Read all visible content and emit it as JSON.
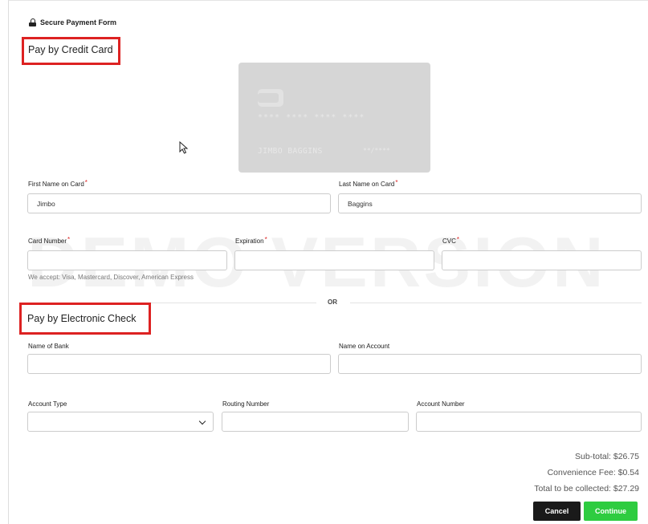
{
  "header": {
    "secure_label": "Secure Payment Form"
  },
  "credit_card": {
    "title": "Pay by Credit Card",
    "preview": {
      "number": "**** **** **** ****",
      "name": "JIMBO BAGGINS",
      "expiry": "**/****"
    },
    "first_name": {
      "label": "First Name on Card",
      "value": "Jimbo"
    },
    "last_name": {
      "label": "Last Name on Card",
      "value": "Baggins"
    },
    "card_number": {
      "label": "Card Number",
      "value": ""
    },
    "expiration": {
      "label": "Expiration",
      "value": ""
    },
    "cvc": {
      "label": "CVC",
      "value": ""
    },
    "accepted": "We accept: Visa, Mastercard, Discover, American Express",
    "required_mark": "*"
  },
  "watermark": "DEMO VERSION",
  "divider": "OR",
  "check": {
    "title": "Pay by Electronic Check",
    "bank_name": {
      "label": "Name of Bank",
      "value": ""
    },
    "account_name": {
      "label": "Name on Account",
      "value": ""
    },
    "account_type": {
      "label": "Account Type",
      "value": ""
    },
    "routing_number": {
      "label": "Routing Number",
      "value": ""
    },
    "account_number": {
      "label": "Account Number",
      "value": ""
    }
  },
  "totals": {
    "subtotal": "Sub-total: $26.75",
    "fee": "Convenience Fee: $0.54",
    "total": "Total to be collected: $27.29"
  },
  "buttons": {
    "cancel": "Cancel",
    "continue": "Continue"
  },
  "colors": {
    "highlight_box": "#dd2222",
    "continue_button": "#2ecc40",
    "cancel_button": "#1a1a1a"
  }
}
